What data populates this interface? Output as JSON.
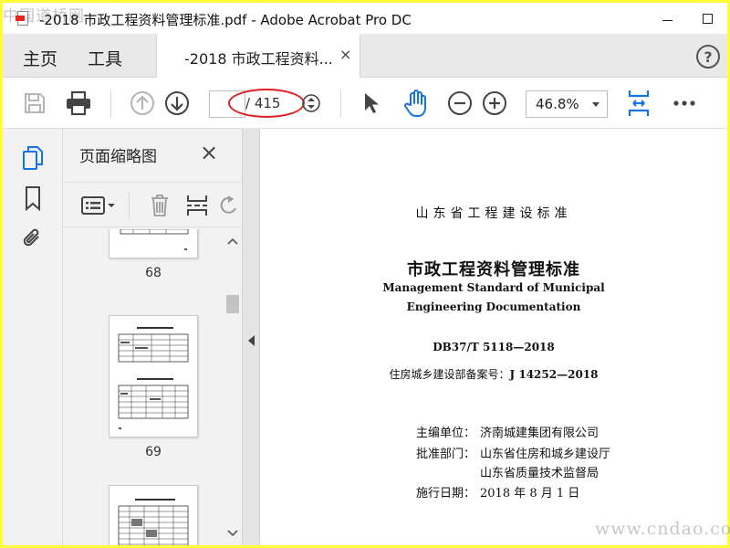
{
  "window": {
    "title": "-2018 市政工程资料管理标准.pdf - Adobe Acrobat Pro DC",
    "watermark_logo": "中国道桥网"
  },
  "tabs": {
    "home": "主页",
    "tools": "工具",
    "document": "-2018 市政工程资料...",
    "close": "×",
    "help": "?"
  },
  "toolbar": {
    "page_current": "",
    "page_total": "/ 415",
    "zoom": "46.8%"
  },
  "panel": {
    "title": "页面缩略图",
    "close": "×",
    "thumbnails": [
      {
        "page": "68"
      },
      {
        "page": "69"
      }
    ]
  },
  "document": {
    "series_title": "山东省工程建设标准",
    "title_cn": "市政工程资料管理标准",
    "title_en_1": "Management Standard of Municipal",
    "title_en_2": "Engineering Documentation",
    "code": "DB37/T 5118—2018",
    "record_label": "住房城乡建设部备案号：",
    "record_number": "J 14252—2018",
    "editor_label": "主编单位：",
    "editor_value": "济南城建集团有限公司",
    "approver_label": "批准部门：",
    "approver_value_1": "山东省住房和城乡建设厅",
    "approver_value_2": "山东省质量技术监督局",
    "date_label": "施行日期：",
    "date_value": "2018 年 8 月 1 日"
  },
  "watermark_site": "www.cndao.com",
  "colors": {
    "frame": "#ffff33",
    "accent_blue": "#1473e6",
    "annotation_red": "#e02020"
  }
}
